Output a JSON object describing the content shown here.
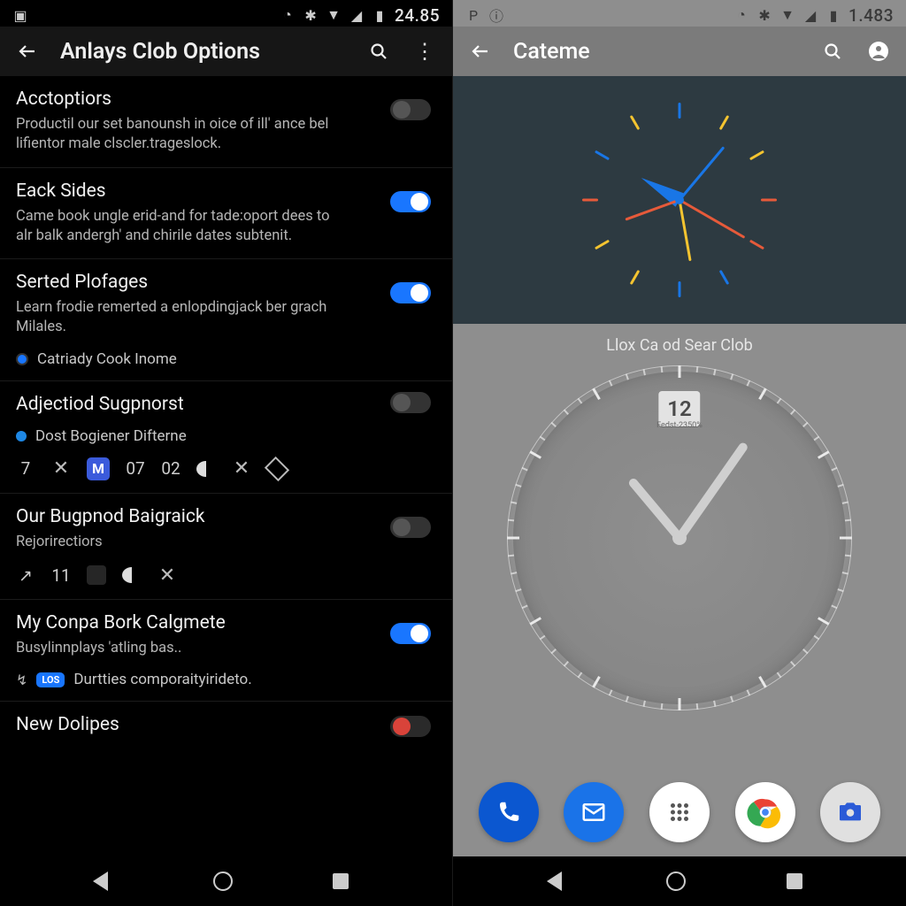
{
  "left": {
    "status_time": "24.85",
    "title": "Anlays Clob Options",
    "sections": [
      {
        "heading": "Acctoptiors",
        "sub": "Productil our set banounsh in oice of ill' ance bel lifientor male clscler.trageslock.",
        "toggle": "off"
      },
      {
        "heading": "Eack Sides",
        "sub": "Came book ungle erid-and for tade:oport dees to alr balk andergh' and chirile dates subtenit.",
        "toggle": "on"
      },
      {
        "heading": "Serted Plofages",
        "sub": "Learn frodie remerted a enlopdingjack ber grach Milales.",
        "extra": "Catriady Cook Inome",
        "toggle": "on"
      },
      {
        "heading": "Adjectiod Sugpnorst",
        "bullet": "Dost Bogiener Difterne",
        "chips": [
          "7",
          "✕",
          "M",
          "07",
          "02",
          "▶",
          "✕",
          "◇"
        ],
        "toggle": "off"
      },
      {
        "heading": "Our Bugpnod Baigraick",
        "sub": "Rejorirectiors",
        "chips2": [
          "↗",
          "11",
          "□",
          "▶",
          "✕"
        ],
        "toggle": "off"
      },
      {
        "heading": "My Conpa Bork Calgmete",
        "sub": "Busylinnplays 'atling bas..",
        "extra2": "Durtties comporaityirideto.",
        "toggle": "on"
      },
      {
        "heading": "New Dolipes",
        "toggle": "red"
      }
    ]
  },
  "right": {
    "status_time": "1.483",
    "title": "Cateme",
    "clock_label": "Llox Ca od Sear Clob",
    "datebox": "12",
    "tiny": "Fedst-2350%",
    "clockA_tick_colors": [
      "#1976e6",
      "#f4c430",
      "#f4c430",
      "#e65a3a",
      "#e65a3a",
      "#1976e6",
      "#1976e6",
      "#f4c430",
      "#f4c430",
      "#e65a3a",
      "#1976e6",
      "#f4c430"
    ]
  }
}
